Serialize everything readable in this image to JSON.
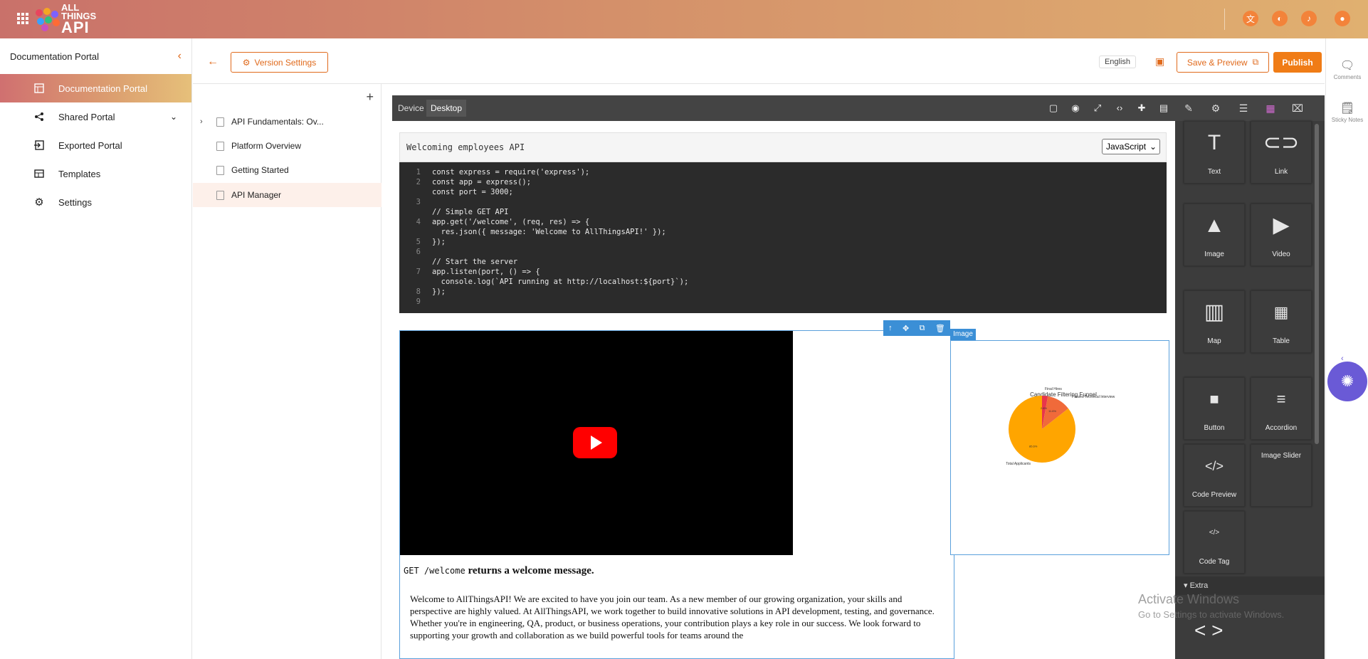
{
  "app": {
    "logo_line1": "ALL",
    "logo_line2": "THINGS",
    "logo_line3": "API"
  },
  "sidebar": {
    "title": "Documentation Portal",
    "items": [
      {
        "label": "Documentation Portal",
        "icon": "portal-icon",
        "active": true
      },
      {
        "label": "Shared Portal",
        "icon": "share-icon"
      },
      {
        "label": "Exported Portal",
        "icon": "export-icon"
      },
      {
        "label": "Templates",
        "icon": "templates-icon"
      },
      {
        "label": "Settings",
        "icon": "gear-icon"
      }
    ]
  },
  "toolbar": {
    "version_settings": "Version Settings",
    "language": "English",
    "save_preview": "Save & Preview",
    "publish": "Publish"
  },
  "tree": {
    "items": [
      {
        "label": "API Fundamentals: Ov..."
      },
      {
        "label": "Platform Overview"
      },
      {
        "label": "Getting Started"
      },
      {
        "label": "API Manager",
        "selected": true
      }
    ]
  },
  "editor": {
    "device_label": "Device",
    "device_value": "Desktop",
    "code_title": "Welcoming employees API",
    "code_language": "JavaScript",
    "code_lines": [
      {
        "n": "1",
        "text": "const express = require('express');"
      },
      {
        "n": "2",
        "text": "const app = express();"
      },
      {
        "n": "",
        "text": "const port = 3000;"
      },
      {
        "n": "3",
        "text": ""
      },
      {
        "n": "",
        "text": "// Simple GET API"
      },
      {
        "n": "4",
        "text": "app.get('/welcome', (req, res) => {"
      },
      {
        "n": "",
        "text": "  res.json({ message: 'Welcome to AllThingsAPI!' });"
      },
      {
        "n": "5",
        "text": "});"
      },
      {
        "n": "6",
        "text": ""
      },
      {
        "n": "",
        "text": "// Start the server"
      },
      {
        "n": "7",
        "text": "app.listen(port, () => {"
      },
      {
        "n": "",
        "text": "  console.log(`API running at http://localhost:${port}`);"
      },
      {
        "n": "8",
        "text": "});"
      },
      {
        "n": "9",
        "text": ""
      }
    ],
    "image_label": "Image",
    "heading_code": "GET /welcome",
    "heading_text": " returns a welcome message.",
    "paragraph": "Welcome to AllThingsAPI! We are excited to have you join our team. As a new member of our growing organization, your skills and perspective are highly valued. At AllThingsAPI, we work together to build innovative solutions in API development, testing, and governance. Whether you're in engineering, QA, product, or business operations, your contribution plays a key role in our success. We look forward to supporting your growth and collaboration as we build powerful tools for teams around the"
  },
  "chart_data": {
    "type": "pie",
    "title": "Candidate Filtering Funnel",
    "categories": [
      "Total Applicants",
      "Passed Technical Interview",
      "Final Hires"
    ],
    "values": [
      85.6,
      11.6,
      2.8
    ],
    "colors": [
      "#ffa500",
      "#f06a3a",
      "#e8364a"
    ],
    "slice_labels": [
      "85.6%",
      "11.6%",
      "2.8%"
    ]
  },
  "blocks": {
    "items": [
      {
        "label": "Text",
        "icon": "text-icon"
      },
      {
        "label": "Link",
        "icon": "link-icon"
      },
      {
        "label": "Image",
        "icon": "image-icon"
      },
      {
        "label": "Video",
        "icon": "video-icon"
      },
      {
        "label": "Map",
        "icon": "map-icon"
      },
      {
        "label": "Table",
        "icon": "table-icon"
      },
      {
        "label": "Button",
        "icon": "button-icon"
      },
      {
        "label": "Accordion",
        "icon": "accordion-icon"
      },
      {
        "label": "Code Preview",
        "icon": "code-icon"
      },
      {
        "label": "Image Slider",
        "icon": "slider-icon"
      },
      {
        "label": "Code Tag",
        "icon": "code-tag-icon"
      }
    ],
    "extra_label": "Extra"
  },
  "rightbar": {
    "comments": "Comments",
    "sticky_notes": "Sticky Notes"
  },
  "watermark": {
    "line1": "Activate Windows",
    "line2": "Go to Settings to activate Windows."
  }
}
